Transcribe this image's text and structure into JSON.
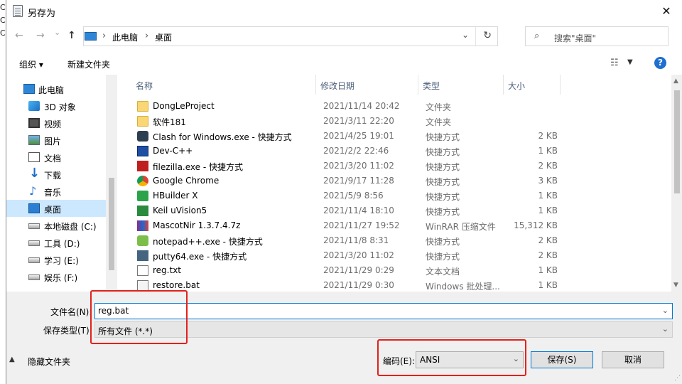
{
  "background_edge": [
    "C",
    "C",
    "C"
  ],
  "window": {
    "title": "另存为",
    "close_glyph": "✕"
  },
  "address": {
    "back_glyph": "←",
    "forward_glyph": "→",
    "recent_glyph": "⌄",
    "up_glyph": "↑",
    "crumbs": [
      "此电脑",
      "桌面"
    ],
    "separator_glyph": "›",
    "dropdown_glyph": "⌄",
    "refresh_glyph": "↻"
  },
  "search": {
    "placeholder": "搜索\"桌面\"",
    "icon_glyph": "⌕"
  },
  "toolbar": {
    "organize": "组织 ▾",
    "new_folder": "新建文件夹",
    "view_glyph": "☷",
    "view_dd_glyph": "▼",
    "help": "?"
  },
  "nav": {
    "items": [
      {
        "label": "此电脑",
        "icon": "pc-icon"
      },
      {
        "label": "3D 对象",
        "icon": "3d-objects-icon"
      },
      {
        "label": "视频",
        "icon": "video-icon"
      },
      {
        "label": "图片",
        "icon": "pictures-icon"
      },
      {
        "label": "文档",
        "icon": "documents-icon"
      },
      {
        "label": "下载",
        "icon": "downloads-icon"
      },
      {
        "label": "音乐",
        "icon": "music-icon"
      },
      {
        "label": "桌面",
        "icon": "desktop-icon",
        "selected": true
      },
      {
        "label": "本地磁盘 (C:)",
        "icon": "drive-icon"
      },
      {
        "label": "工具 (D:)",
        "icon": "drive-icon"
      },
      {
        "label": "学习 (E:)",
        "icon": "drive-icon"
      },
      {
        "label": "娱乐 (F:)",
        "icon": "drive-icon"
      }
    ]
  },
  "columns": {
    "name": "名称",
    "modified": "修改日期",
    "type": "类型",
    "size": "大小",
    "sort_glyph": "^"
  },
  "files": [
    {
      "name": "DongLeProject",
      "date": "2021/11/14 20:42",
      "type": "文件夹",
      "size": "",
      "icon": "folder-icon"
    },
    {
      "name": "软件181",
      "date": "2021/3/11 22:20",
      "type": "文件夹",
      "size": "",
      "icon": "folder-icon"
    },
    {
      "name": "Clash for Windows.exe - 快捷方式",
      "date": "2021/4/25 19:01",
      "type": "快捷方式",
      "size": "2 KB",
      "icon": "clash-icon"
    },
    {
      "name": "Dev-C++",
      "date": "2021/2/2 22:46",
      "type": "快捷方式",
      "size": "1 KB",
      "icon": "devcpp-icon"
    },
    {
      "name": "filezilla.exe - 快捷方式",
      "date": "2021/3/20 11:02",
      "type": "快捷方式",
      "size": "2 KB",
      "icon": "filezilla-icon"
    },
    {
      "name": "Google Chrome",
      "date": "2021/9/17 11:28",
      "type": "快捷方式",
      "size": "3 KB",
      "icon": "chrome-icon"
    },
    {
      "name": "HBuilder X",
      "date": "2021/5/9 8:56",
      "type": "快捷方式",
      "size": "1 KB",
      "icon": "hbuilder-icon"
    },
    {
      "name": "Keil uVision5",
      "date": "2021/11/4 18:10",
      "type": "快捷方式",
      "size": "1 KB",
      "icon": "keil-icon"
    },
    {
      "name": "MascotNir 1.3.7.4.7z",
      "date": "2021/11/27 19:52",
      "type": "WinRAR 压缩文件",
      "size": "15,312 KB",
      "icon": "winrar-icon"
    },
    {
      "name": "notepad++.exe - 快捷方式",
      "date": "2021/11/8 8:31",
      "type": "快捷方式",
      "size": "2 KB",
      "icon": "notepadpp-icon"
    },
    {
      "name": "putty64.exe - 快捷方式",
      "date": "2021/3/20 11:02",
      "type": "快捷方式",
      "size": "2 KB",
      "icon": "putty-icon"
    },
    {
      "name": "reg.txt",
      "date": "2021/11/29 0:29",
      "type": "文本文档",
      "size": "1 KB",
      "icon": "text-file-icon"
    },
    {
      "name": "restore.bat",
      "date": "2021/11/29 0:30",
      "type": "Windows 批处理...",
      "size": "1 KB",
      "icon": "batch-file-icon"
    }
  ],
  "scroll": {
    "up_glyph": "▲",
    "down_glyph": "▼"
  },
  "form": {
    "filename_label": "文件名(N):",
    "filename_value": "reg.bat",
    "filetype_label": "保存类型(T):",
    "filetype_value": "所有文件 (*.*)",
    "encoding_label": "编码(E):",
    "encoding_value": "ANSI",
    "combo_glyph": "⌄",
    "save": "保存(S)",
    "cancel": "取消",
    "hide_folders": "隐藏文件夹",
    "hide_glyph": "▲",
    "grip_glyph": "⋰"
  },
  "colors": {
    "highlight": "#e2211c",
    "selection": "#cce8ff",
    "accent": "#0078d7"
  }
}
